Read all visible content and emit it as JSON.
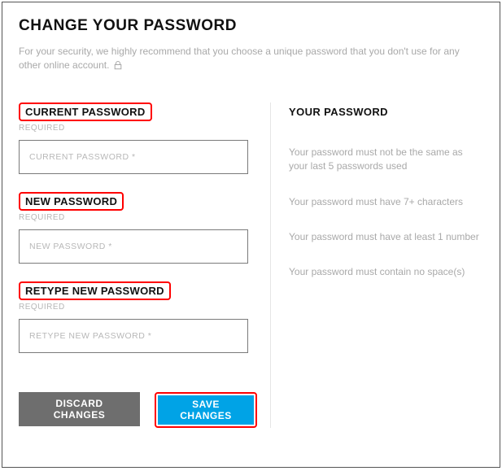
{
  "title": "CHANGE YOUR PASSWORD",
  "description": "For your security, we highly recommend that you choose a unique password that you don't use for any other online account.",
  "fields": {
    "current": {
      "label": "CURRENT PASSWORD",
      "required": "REQUIRED",
      "placeholder": "CURRENT PASSWORD *"
    },
    "new": {
      "label": "NEW PASSWORD",
      "required": "REQUIRED",
      "placeholder": "NEW PASSWORD *"
    },
    "retype": {
      "label": "RETYPE NEW PASSWORD",
      "required": "REQUIRED",
      "placeholder": "RETYPE NEW PASSWORD *"
    }
  },
  "buttons": {
    "discard": "DISCARD CHANGES",
    "save": "SAVE CHANGES"
  },
  "rulesTitle": "YOUR PASSWORD",
  "rules": [
    "Your password must not be the same as your last 5 passwords used",
    "Your password must have 7+ characters",
    "Your password must have at least 1 number",
    "Your password must contain no space(s)"
  ]
}
